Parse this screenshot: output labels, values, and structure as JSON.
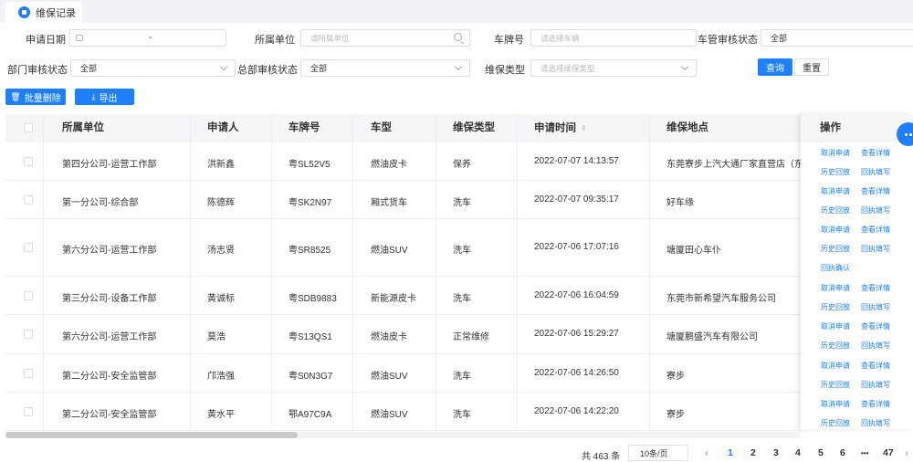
{
  "tab": {
    "title": "维保记录"
  },
  "filters": {
    "apply_date_label": "申请日期",
    "apply_date_sep": "-",
    "unit_label": "所属单位",
    "unit_placeholder": "请所属单位",
    "plate_label": "车牌号",
    "plate_placeholder": "请选择车辆",
    "fleet_status_label": "车管审核状态",
    "fleet_status_value": "全部",
    "dept_status_label": "部门审核状态",
    "dept_status_value": "全部",
    "hq_status_label": "总部审核状态",
    "hq_status_value": "全部",
    "type_label": "维保类型",
    "type_placeholder": "请选择维保类型",
    "query_button": "查询",
    "reset_button": "重置"
  },
  "toolbar": {
    "batch_delete": "批量删除",
    "export": "导出"
  },
  "table": {
    "columns": [
      "所属单位",
      "申请人",
      "车牌号",
      "车型",
      "维保类型",
      "申请时间",
      "维保地点",
      "操作"
    ],
    "rows": [
      {
        "unit": "第四分公司-运营工作部",
        "applicant": "洪新鑫",
        "plate": "粤SL52V5",
        "model": "燃油皮卡",
        "type": "保养",
        "time": "2022-07-07 14:13:57",
        "location": "东莞寮步上汽大通厂家直营店（东莞",
        "actions": [
          [
            "取消申请",
            "查看详情"
          ],
          [
            "历史回放",
            "回执填写"
          ]
        ]
      },
      {
        "unit": "第一分公司-综合部",
        "applicant": "陈德辉",
        "plate": "粤SK2N97",
        "model": "厢式货车",
        "type": "洗车",
        "time": "2022-07-07 09:35:17",
        "location": "好车缘",
        "actions": [
          [
            "取消申请",
            "查看详情"
          ],
          [
            "历史回放",
            "回执填写"
          ]
        ]
      },
      {
        "unit": "第六分公司-运营工作部",
        "applicant": "汤志贤",
        "plate": "粤SR8525",
        "model": "燃油SUV",
        "type": "洗车",
        "time": "2022-07-06 17:07:16",
        "location": "塘厦田心车仆",
        "actions": [
          [
            "取消申请",
            "查看详情"
          ],
          [
            "历史回放",
            "回执填写"
          ],
          [
            "回执确认"
          ]
        ]
      },
      {
        "unit": "第三分公司-设备工作部",
        "applicant": "黄诚标",
        "plate": "粤SDB9883",
        "model": "新能源皮卡",
        "type": "洗车",
        "time": "2022-07-06 16:04:59",
        "location": "东莞市新希望汽车服务公司",
        "actions": [
          [
            "取消申请",
            "查看详情"
          ],
          [
            "历史回放",
            "回执填写"
          ]
        ]
      },
      {
        "unit": "第六分公司-运营工作部",
        "applicant": "莫浩",
        "plate": "粤S13QS1",
        "model": "燃油皮卡",
        "type": "正常维修",
        "time": "2022-07-06 15:29:27",
        "location": "塘厦鹏盛汽车有限公司",
        "actions": [
          [
            "取消申请",
            "查看详情"
          ],
          [
            "历史回放",
            "回执填写"
          ]
        ]
      },
      {
        "unit": "第二分公司-安全监管部",
        "applicant": "邝浩强",
        "plate": "粤S0N3G7",
        "model": "燃油SUV",
        "type": "洗车",
        "time": "2022-07-06 14:26:50",
        "location": "寮步",
        "actions": [
          [
            "取消申请",
            "查看详情"
          ],
          [
            "历史回放",
            "回执填写"
          ]
        ]
      },
      {
        "unit": "第二分公司-安全监管部",
        "applicant": "黄水平",
        "plate": "鄂A97C9A",
        "model": "燃油SUV",
        "type": "洗车",
        "time": "2022-07-06 14:22:20",
        "location": "寮步",
        "actions": [
          [
            "取消申请",
            "查看详情"
          ],
          [
            "历史回放",
            "回执填写"
          ]
        ]
      }
    ]
  },
  "pagination": {
    "total": "共 463 条",
    "page_size": "10条/页",
    "pages": [
      "1",
      "2",
      "3",
      "4",
      "5",
      "6",
      "•••",
      "47"
    ],
    "current": "1",
    "prev": "‹"
  },
  "colors": {
    "accent": "#1e80ff"
  }
}
